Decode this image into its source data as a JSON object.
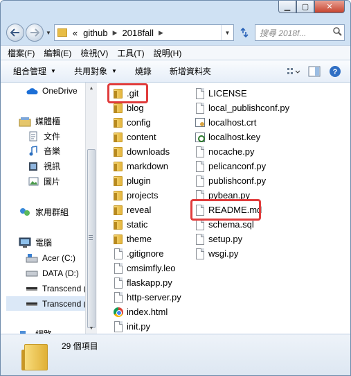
{
  "address": {
    "prefix": "«",
    "crumbs": [
      "github",
      "2018fall"
    ],
    "search_placeholder": "搜尋 2018f..."
  },
  "menu": [
    "檔案(F)",
    "編輯(E)",
    "檢視(V)",
    "工具(T)",
    "說明(H)"
  ],
  "commands": {
    "organize": "組合管理",
    "share": "共用對象",
    "burn": "燒錄",
    "new_folder": "新增資料夾"
  },
  "nav": {
    "onedrive": "OneDrive",
    "libraries": "媒體櫃",
    "documents": "文件",
    "music": "音樂",
    "videos": "視訊",
    "pictures": "圖片",
    "homegroup": "家用群組",
    "computer": "電腦",
    "acer": "Acer (C:)",
    "data": "DATA (D:)",
    "transcend1": "Transcend (",
    "transcend2": "Transcend (",
    "network": "網路"
  },
  "files_col1": [
    ".git",
    "blog",
    "config",
    "content",
    "downloads",
    "markdown",
    "plugin",
    "projects",
    "reveal",
    "static",
    "theme",
    ".gitignore",
    "cmsimfly.leo",
    "flaskapp.py",
    "http-server.py",
    "index.html",
    "init.py"
  ],
  "files_col2": [
    "LICENSE",
    "local_publishconf.py",
    "localhost.crt",
    "localhost.key",
    "nocache.py",
    "pelicanconf.py",
    "publishconf.py",
    "pybean.py",
    "README.md",
    "schema.sql",
    "setup.py",
    "wsgi.py"
  ],
  "status": {
    "count": "29 個項目"
  },
  "colors": {
    "highlight": "#e03b3b",
    "folder": "#e8bd45"
  }
}
